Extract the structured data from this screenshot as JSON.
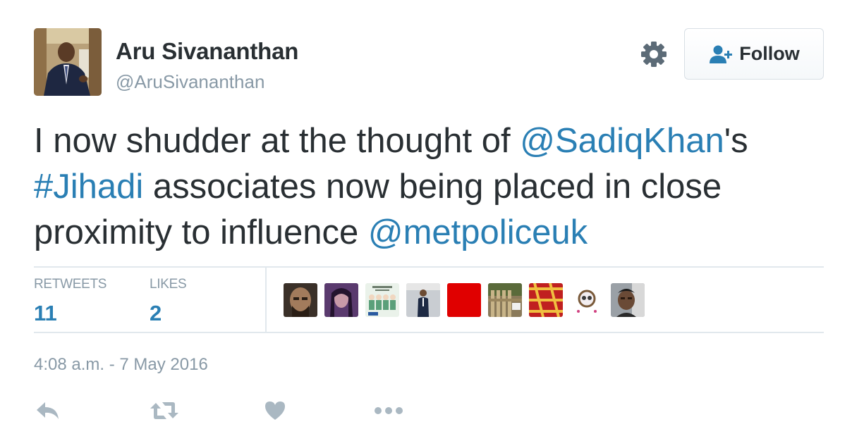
{
  "author": {
    "name": "Aru Sivananthan",
    "handle": "@AruSivananthan",
    "avatar_icon": "profile-photo"
  },
  "header": {
    "settings_icon": "gear-icon",
    "follow_label": "Follow",
    "follow_icon": "add-user-icon"
  },
  "tweet": {
    "parts": [
      {
        "text": "I now shudder at the thought of ",
        "link": false
      },
      {
        "text": "@SadiqKhan",
        "link": true
      },
      {
        "text": "'s ",
        "link": false
      },
      {
        "text": "#Jihadi",
        "link": true
      },
      {
        "text": " associates now being placed in close proximity to influence ",
        "link": false
      },
      {
        "text": "@metpoliceuk",
        "link": true
      }
    ]
  },
  "stats": {
    "retweets_label": "RETWEETS",
    "retweets_value": "11",
    "likes_label": "LIKES",
    "likes_value": "2"
  },
  "likers": [
    {
      "icon": "liker-avatar-1",
      "color": "#3a3028"
    },
    {
      "icon": "liker-avatar-2",
      "color": "#5a3a6e"
    },
    {
      "icon": "liker-avatar-3",
      "color": "#eaf2ea"
    },
    {
      "icon": "liker-avatar-4",
      "color": "#c9cdd2"
    },
    {
      "icon": "liker-avatar-5",
      "color": "#e00000"
    },
    {
      "icon": "liker-avatar-6",
      "color": "#8a7a5a"
    },
    {
      "icon": "liker-avatar-7",
      "color": "#c02020"
    },
    {
      "icon": "liker-avatar-8",
      "color": "#f3eef0"
    },
    {
      "icon": "liker-avatar-9",
      "color": "#9aa0a6"
    }
  ],
  "timestamp": "4:08 a.m. - 7 May 2016",
  "actions": {
    "reply_icon": "reply-icon",
    "retweet_icon": "retweet-icon",
    "like_icon": "heart-icon",
    "more_icon": "more-icon",
    "icon_color": "#aab8c2"
  },
  "colors": {
    "link": "#2a7fb4",
    "text": "#292f33",
    "muted": "#8899a6",
    "rule": "#e1e8ed"
  }
}
